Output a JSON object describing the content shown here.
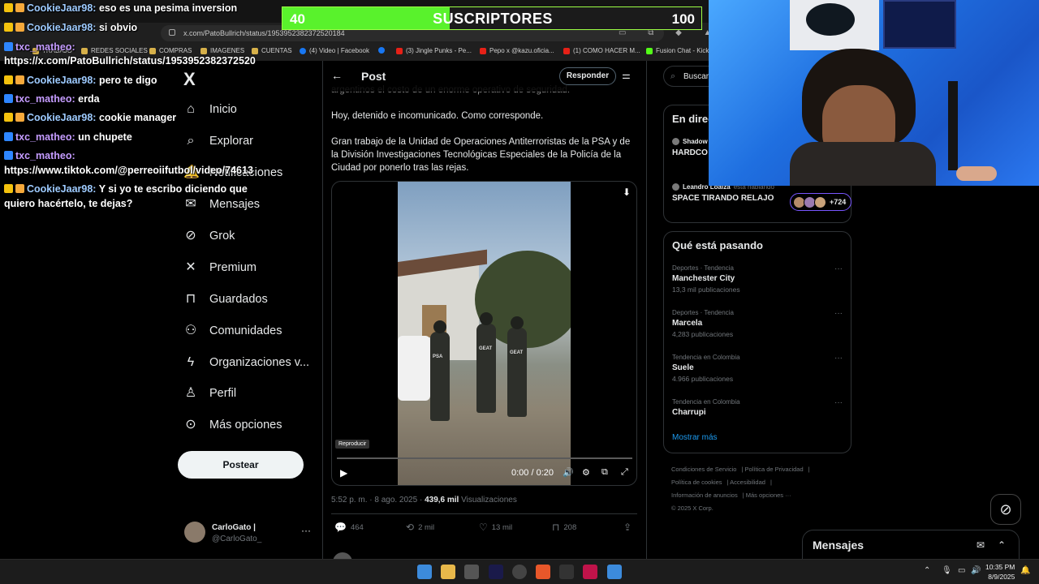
{
  "browser": {
    "url": "x.com/PatoBullrich/status/1953952382372520184",
    "bookmarks": [
      "TRABAJO",
      "REDES SOCIALES",
      "COMPRAS",
      "IMAGENES",
      "CUENTAS",
      "(4) Video | Facebook",
      "(3) Jingle Punks - Pe...",
      "Pepo x @kazu.oficia...",
      "(1) COMO HACER M...",
      "Fusion Chat - Kick"
    ]
  },
  "x_nav": {
    "logo": "X",
    "items": [
      {
        "label": "Inicio",
        "icon": "home-icon",
        "glyph": "⌂"
      },
      {
        "label": "Explorar",
        "icon": "search-icon",
        "glyph": "⌕"
      },
      {
        "label": "Notificaciones",
        "icon": "bell-icon",
        "glyph": "🔔"
      },
      {
        "label": "Mensajes",
        "icon": "envelope-icon",
        "glyph": "✉"
      },
      {
        "label": "Grok",
        "icon": "grok-icon",
        "glyph": "⊘"
      },
      {
        "label": "Premium",
        "icon": "x-premium-icon",
        "glyph": "✕"
      },
      {
        "label": "Guardados",
        "icon": "bookmark-icon",
        "glyph": "⊓"
      },
      {
        "label": "Comunidades",
        "icon": "communities-icon",
        "glyph": "⚇"
      },
      {
        "label": "Organizaciones v...",
        "icon": "lightning-icon",
        "glyph": "ϟ"
      },
      {
        "label": "Perfil",
        "icon": "person-icon",
        "glyph": "♙"
      },
      {
        "label": "Más opciones",
        "icon": "more-circle-icon",
        "glyph": "⊙"
      }
    ],
    "post_button": "Postear",
    "profile": {
      "name": "CarloGato |",
      "handle": "@CarloGato_",
      "more": "···"
    }
  },
  "post": {
    "header_title": "Post",
    "reply_button": "Responder",
    "text_partial": "argentinos el costo de un enorme operativo de seguridad.",
    "text_1": "Hoy, detenido e incomunicado. Como corresponde.",
    "text_2": "Gran trabajo de la Unidad de Operaciones Antiterroristas de la PSA y de la División Investigaciones Tecnológicas Especiales de la Policía de la Ciudad por ponerlo tras las rejas.",
    "video": {
      "tooltip": "Reproducir",
      "time": "0:00 / 0:20",
      "vest_labels": [
        "PSA",
        "GEAT",
        "GEAT"
      ],
      "progress": 0
    },
    "meta": {
      "time": "5:52 p. m. · 8 ago. 2025 · ",
      "views": "439,6 mil",
      "views_label": " Visualizaciones"
    },
    "actions": {
      "replies": "464",
      "reposts": "2 mil",
      "likes": "13 mil",
      "bookmarks": "208"
    }
  },
  "sidebar": {
    "search_placeholder": "Buscar",
    "live": {
      "title": "En directo",
      "items": [
        {
          "host": "Shadow",
          "muted": "",
          "title": "HARDCO"
        },
        {
          "host": "Leandro Loaiza",
          "muted": "está hablando",
          "title": "SPACE TIRANDO RELAJO",
          "listeners": "+724"
        }
      ]
    },
    "trends": {
      "title": "Qué está pasando",
      "items": [
        {
          "category": "Deportes · Tendencia",
          "name": "Manchester City",
          "count": "13,3 mil publicaciones"
        },
        {
          "category": "Deportes · Tendencia",
          "name": "Marcela",
          "count": "4,283 publicaciones"
        },
        {
          "category": "Tendencia en Colombia",
          "name": "Suele",
          "count": "4.966 publicaciones"
        },
        {
          "category": "Tendencia en Colombia",
          "name": "Charrupi",
          "count": ""
        }
      ],
      "show_more": "Mostrar más"
    },
    "footer": [
      "Condiciones de Servicio",
      "Política de Privacidad",
      "Política de cookies",
      "Accesibilidad",
      "Información de anuncios",
      "Más opciones ···",
      "© 2025 X Corp."
    ],
    "messages_dock": "Mensajes"
  },
  "stream": {
    "chat": [
      {
        "user": "CookieJaar98:",
        "msg": "eso es una pesima inversion",
        "badges": [
          "crown",
          "gift"
        ],
        "color": "cookie"
      },
      {
        "user": "CookieJaar98:",
        "msg": "si obvio",
        "badges": [
          "crown",
          "gift"
        ],
        "color": "cookie"
      },
      {
        "user": "txc_matheo:",
        "msg": "",
        "badges": [
          "ticket"
        ],
        "color": "txc"
      },
      {
        "user": "",
        "msg": "https://x.com/PatoBullrich/status/1953952382372520",
        "badges": [],
        "color": ""
      },
      {
        "user": "CookieJaar98:",
        "msg": "pero te digo",
        "badges": [
          "crown",
          "gift"
        ],
        "color": "cookie"
      },
      {
        "user": "txc_matheo:",
        "msg": "erda",
        "badges": [
          "ticket"
        ],
        "color": "txc"
      },
      {
        "user": "CookieJaar98:",
        "msg": "cookie manager",
        "badges": [
          "crown",
          "gift"
        ],
        "color": "cookie"
      },
      {
        "user": "txc_matheo:",
        "msg": "un chupete",
        "badges": [
          "ticket"
        ],
        "color": "txc"
      },
      {
        "user": "txc_matheo:",
        "msg": "",
        "badges": [
          "ticket"
        ],
        "color": "txc"
      },
      {
        "user": "",
        "msg": "https://www.tiktok.com/@perreoiifutbol/video/74613",
        "badges": [],
        "color": ""
      },
      {
        "user": "CookieJaar98:",
        "msg": "Y si yo te escribo diciendo que",
        "badges": [
          "crown",
          "gift"
        ],
        "color": "cookie"
      },
      {
        "user": "",
        "msg": "quiero hacértelo, te dejas?",
        "badges": [],
        "color": ""
      }
    ],
    "sub_goal": {
      "current": "40",
      "label": "SUSCRIPTORES",
      "target": "100",
      "progress": 0.4
    }
  },
  "taskbar": {
    "time": "10:35 PM",
    "date": "8/9/2025"
  },
  "colors": {
    "x_blue": "#1d9bf0",
    "goal_green": "#59f22c",
    "spaces_purple": "#7856ff"
  }
}
